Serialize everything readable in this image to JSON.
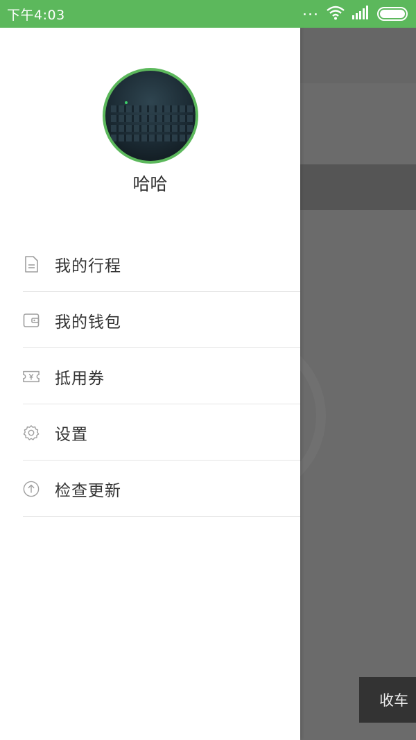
{
  "status_bar": {
    "time": "下午4:03",
    "dots": "..."
  },
  "user": {
    "name": "哈哈"
  },
  "menu": {
    "items": [
      {
        "label": "我的行程",
        "icon": "document-icon"
      },
      {
        "label": "我的钱包",
        "icon": "wallet-icon"
      },
      {
        "label": "抵用券",
        "icon": "coupon-icon"
      },
      {
        "label": "设置",
        "icon": "gear-icon"
      },
      {
        "label": "检查更新",
        "icon": "arrow-up-circle-icon"
      }
    ]
  },
  "background": {
    "shoucha_label": "收车"
  },
  "colors": {
    "accent": "#5cb85c",
    "icon_gray": "#9e9e9e"
  }
}
